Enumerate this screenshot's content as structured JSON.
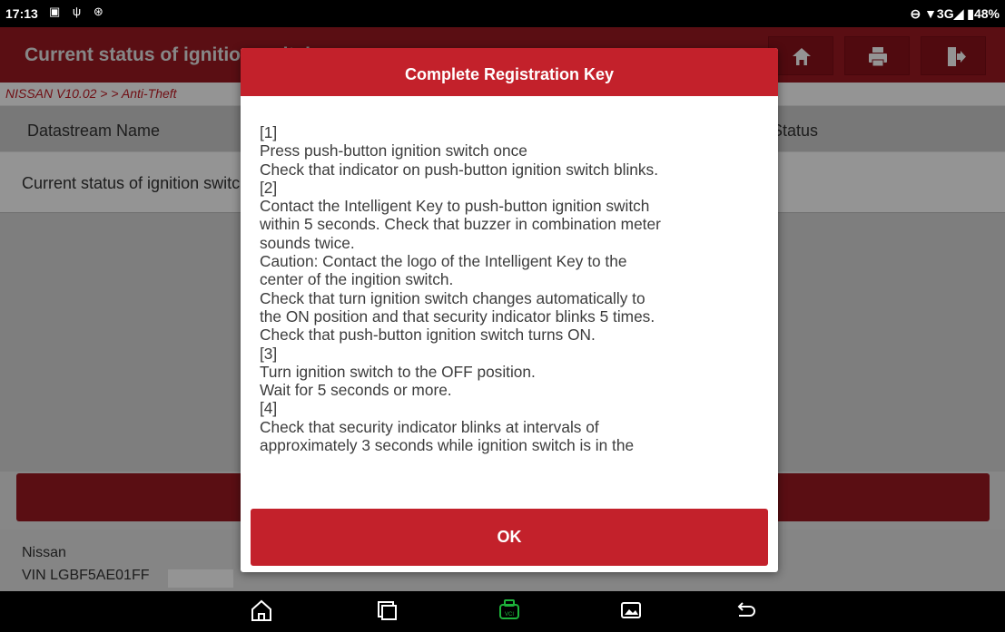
{
  "status_bar": {
    "time": "17:13",
    "right": "⊖ ▼3G◢ ▮48%"
  },
  "header": {
    "title": "Current status of ignition switch"
  },
  "breadcrumb": "NISSAN V10.02 >  > Anti-Theft",
  "table": {
    "headers": [
      "Datastream Name",
      "Status"
    ],
    "rows": [
      {
        "name": "Current status of ignition switch"
      }
    ]
  },
  "footer": {
    "make": "Nissan",
    "vin_label": "VIN LGBF5AE01FF"
  },
  "dialog": {
    "title": "Complete Registration Key",
    "lines": [
      "[1]",
      "Press push-button ignition switch once",
      "Check that indicator on push-button ignition switch blinks.",
      "[2]",
      "Contact the Intelligent Key to push-button ignition switch",
      "within 5 seconds. Check that buzzer in combination meter",
      "sounds twice.",
      "Caution: Contact the logo of the Intelligent Key to the",
      "center of the ingition switch.",
      "Check that turn ignition switch changes automatically to",
      "the ON position and that security indicator blinks 5 times.",
      "Check that push-button ignition switch turns ON.",
      "[3]",
      "Turn ignition switch to the OFF position.",
      "Wait for 5 seconds or more.",
      "[4]",
      "Check that security indicator blinks at intervals of",
      "approximately 3 seconds while ignition switch is in the"
    ],
    "ok_label": "OK"
  },
  "icons": {
    "header": [
      "home-icon",
      "print-icon",
      "exit-icon"
    ],
    "nav": [
      "home-nav-icon",
      "recent-apps-icon",
      "vci-icon",
      "screenshot-icon",
      "back-icon"
    ]
  },
  "colors": {
    "brand_red": "#9b1922",
    "dialog_red": "#c3212b",
    "vci_green": "#1db33a"
  }
}
